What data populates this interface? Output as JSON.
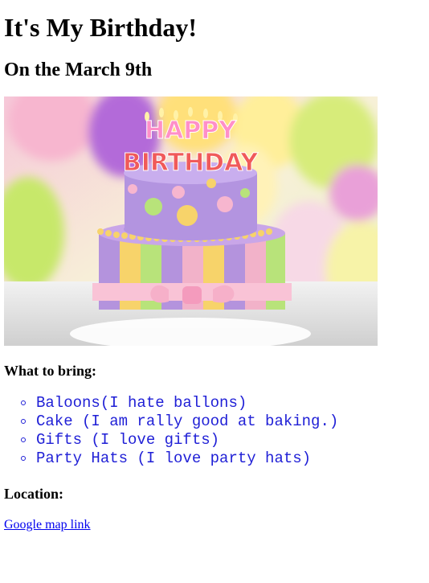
{
  "title": "It's My Birthday!",
  "subtitle": "On the March 9th",
  "image": {
    "cake_text_line1": "HAPPY",
    "cake_text_line2": "BIRTHDAY"
  },
  "bring": {
    "heading": "What to bring:",
    "items": [
      "Baloons(I hate ballons)",
      "Cake (I am rally good at baking.)",
      "Gifts (I love gifts)",
      "Party Hats (I love party hats)"
    ]
  },
  "location": {
    "heading": "Location:",
    "link_text": "Google map link"
  },
  "colors": {
    "list_text": "#1f1fd6",
    "link": "#0000ee"
  }
}
